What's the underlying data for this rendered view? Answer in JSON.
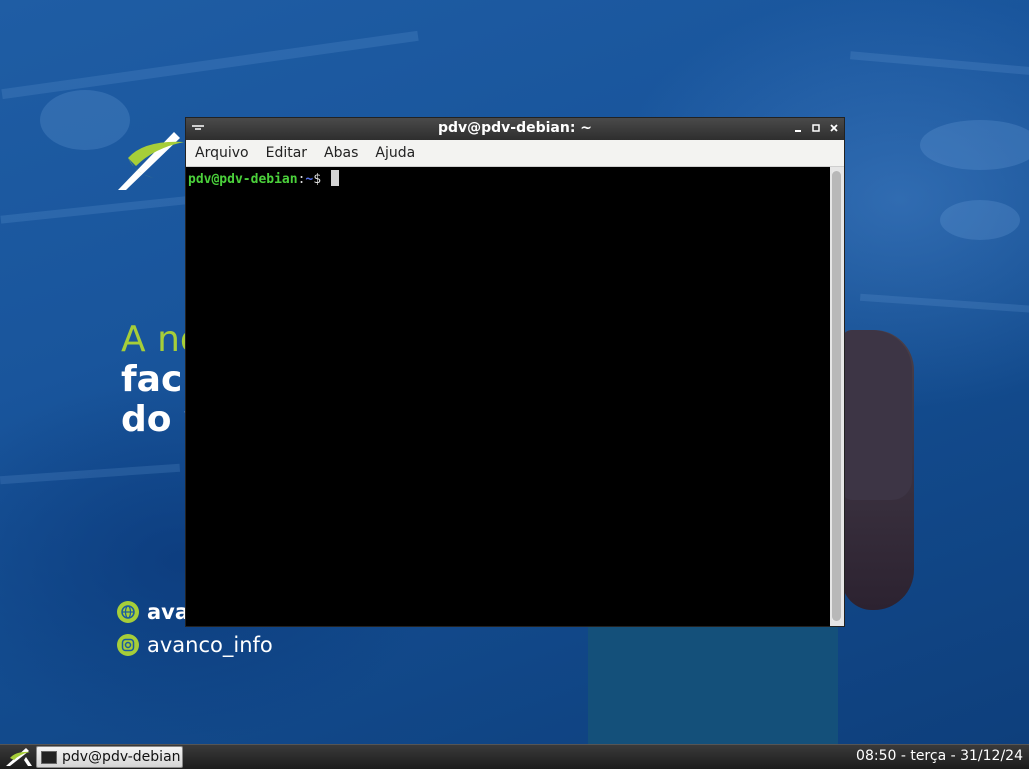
{
  "desktop": {
    "headline": {
      "line1": "A no",
      "line2": "faci",
      "line3": "do v"
    },
    "social": [
      {
        "icon": "globe-icon",
        "text": "avan"
      },
      {
        "icon": "instagram-icon",
        "text": "avanco_info"
      }
    ],
    "colors": {
      "accent": "#a6ce39",
      "wallpaper": "#1a5aa0"
    }
  },
  "window": {
    "title": "pdv@pdv-debian: ~",
    "menu": [
      "Arquivo",
      "Editar",
      "Abas",
      "Ajuda"
    ],
    "terminal": {
      "user": "pdv@pdv-debian",
      "separator": ":",
      "path": "~",
      "symbol": "$"
    }
  },
  "taskbar": {
    "task_label": "pdv@pdv-debian...",
    "clock": "08:50 - terça - 31/12/24"
  }
}
